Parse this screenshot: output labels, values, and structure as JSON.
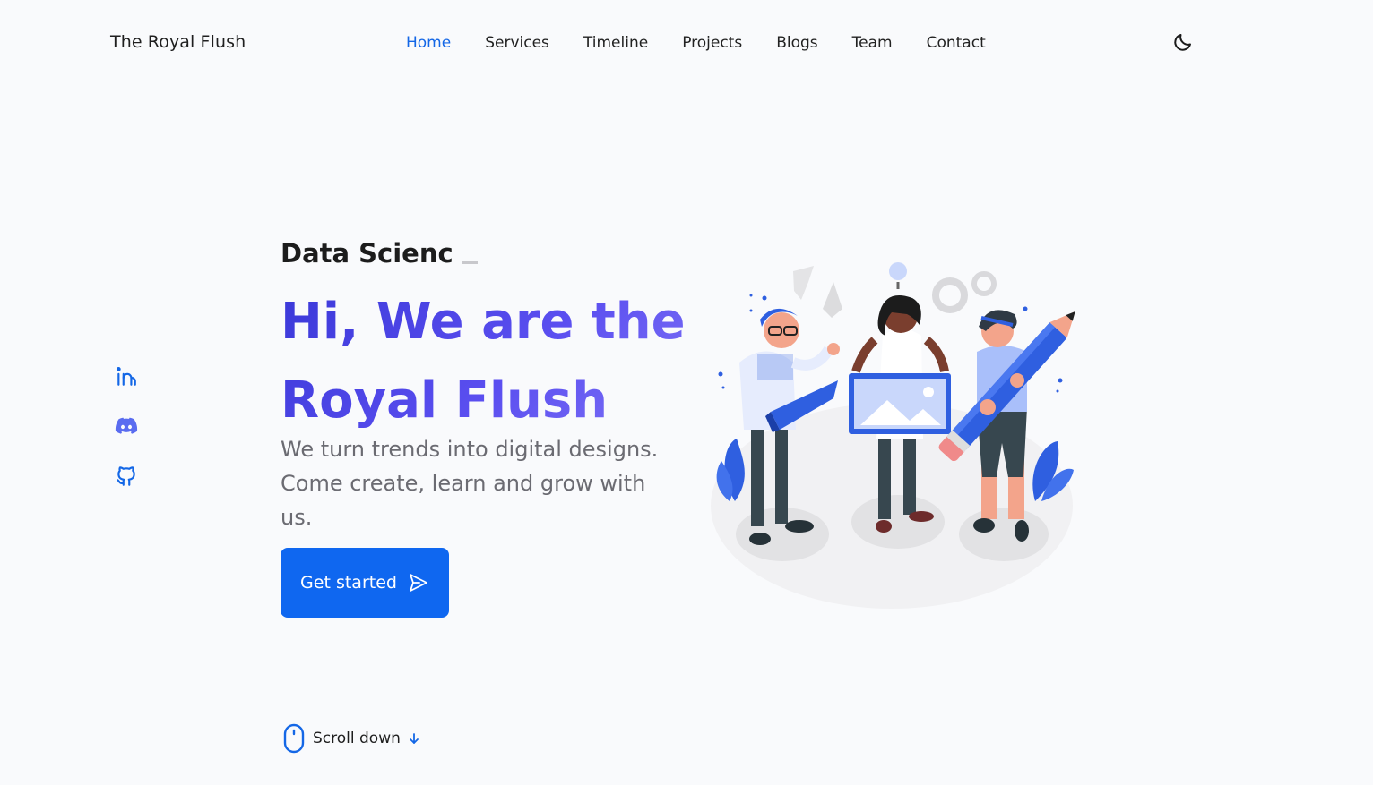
{
  "brand": {
    "name": "The Royal Flush"
  },
  "nav": {
    "items": [
      {
        "label": "Home",
        "active": true
      },
      {
        "label": "Services",
        "active": false
      },
      {
        "label": "Timeline",
        "active": false
      },
      {
        "label": "Projects",
        "active": false
      },
      {
        "label": "Blogs",
        "active": false
      },
      {
        "label": "Team",
        "active": false
      },
      {
        "label": "Contact",
        "active": false
      }
    ],
    "theme_toggle_icon": "moon-icon"
  },
  "social": [
    "linkedin-icon",
    "discord-icon",
    "github-icon"
  ],
  "hero": {
    "subtitle": "Data Scienc",
    "headline_line1": "Hi, We are the",
    "headline_line2": "Royal Flush",
    "tagline": "We turn trends into digital designs. Come create, learn and grow with us.",
    "cta_label": "Get started",
    "cta_icon": "send-icon",
    "scroll_label": "Scroll down",
    "scroll_icon": "mouse-icon"
  },
  "colors": {
    "accent": "#0f67f0",
    "active_nav": "#1467e6",
    "headline_gradient_start": "#3a38d8",
    "headline_gradient_end": "#8478f7",
    "background": "#f9fafc"
  }
}
